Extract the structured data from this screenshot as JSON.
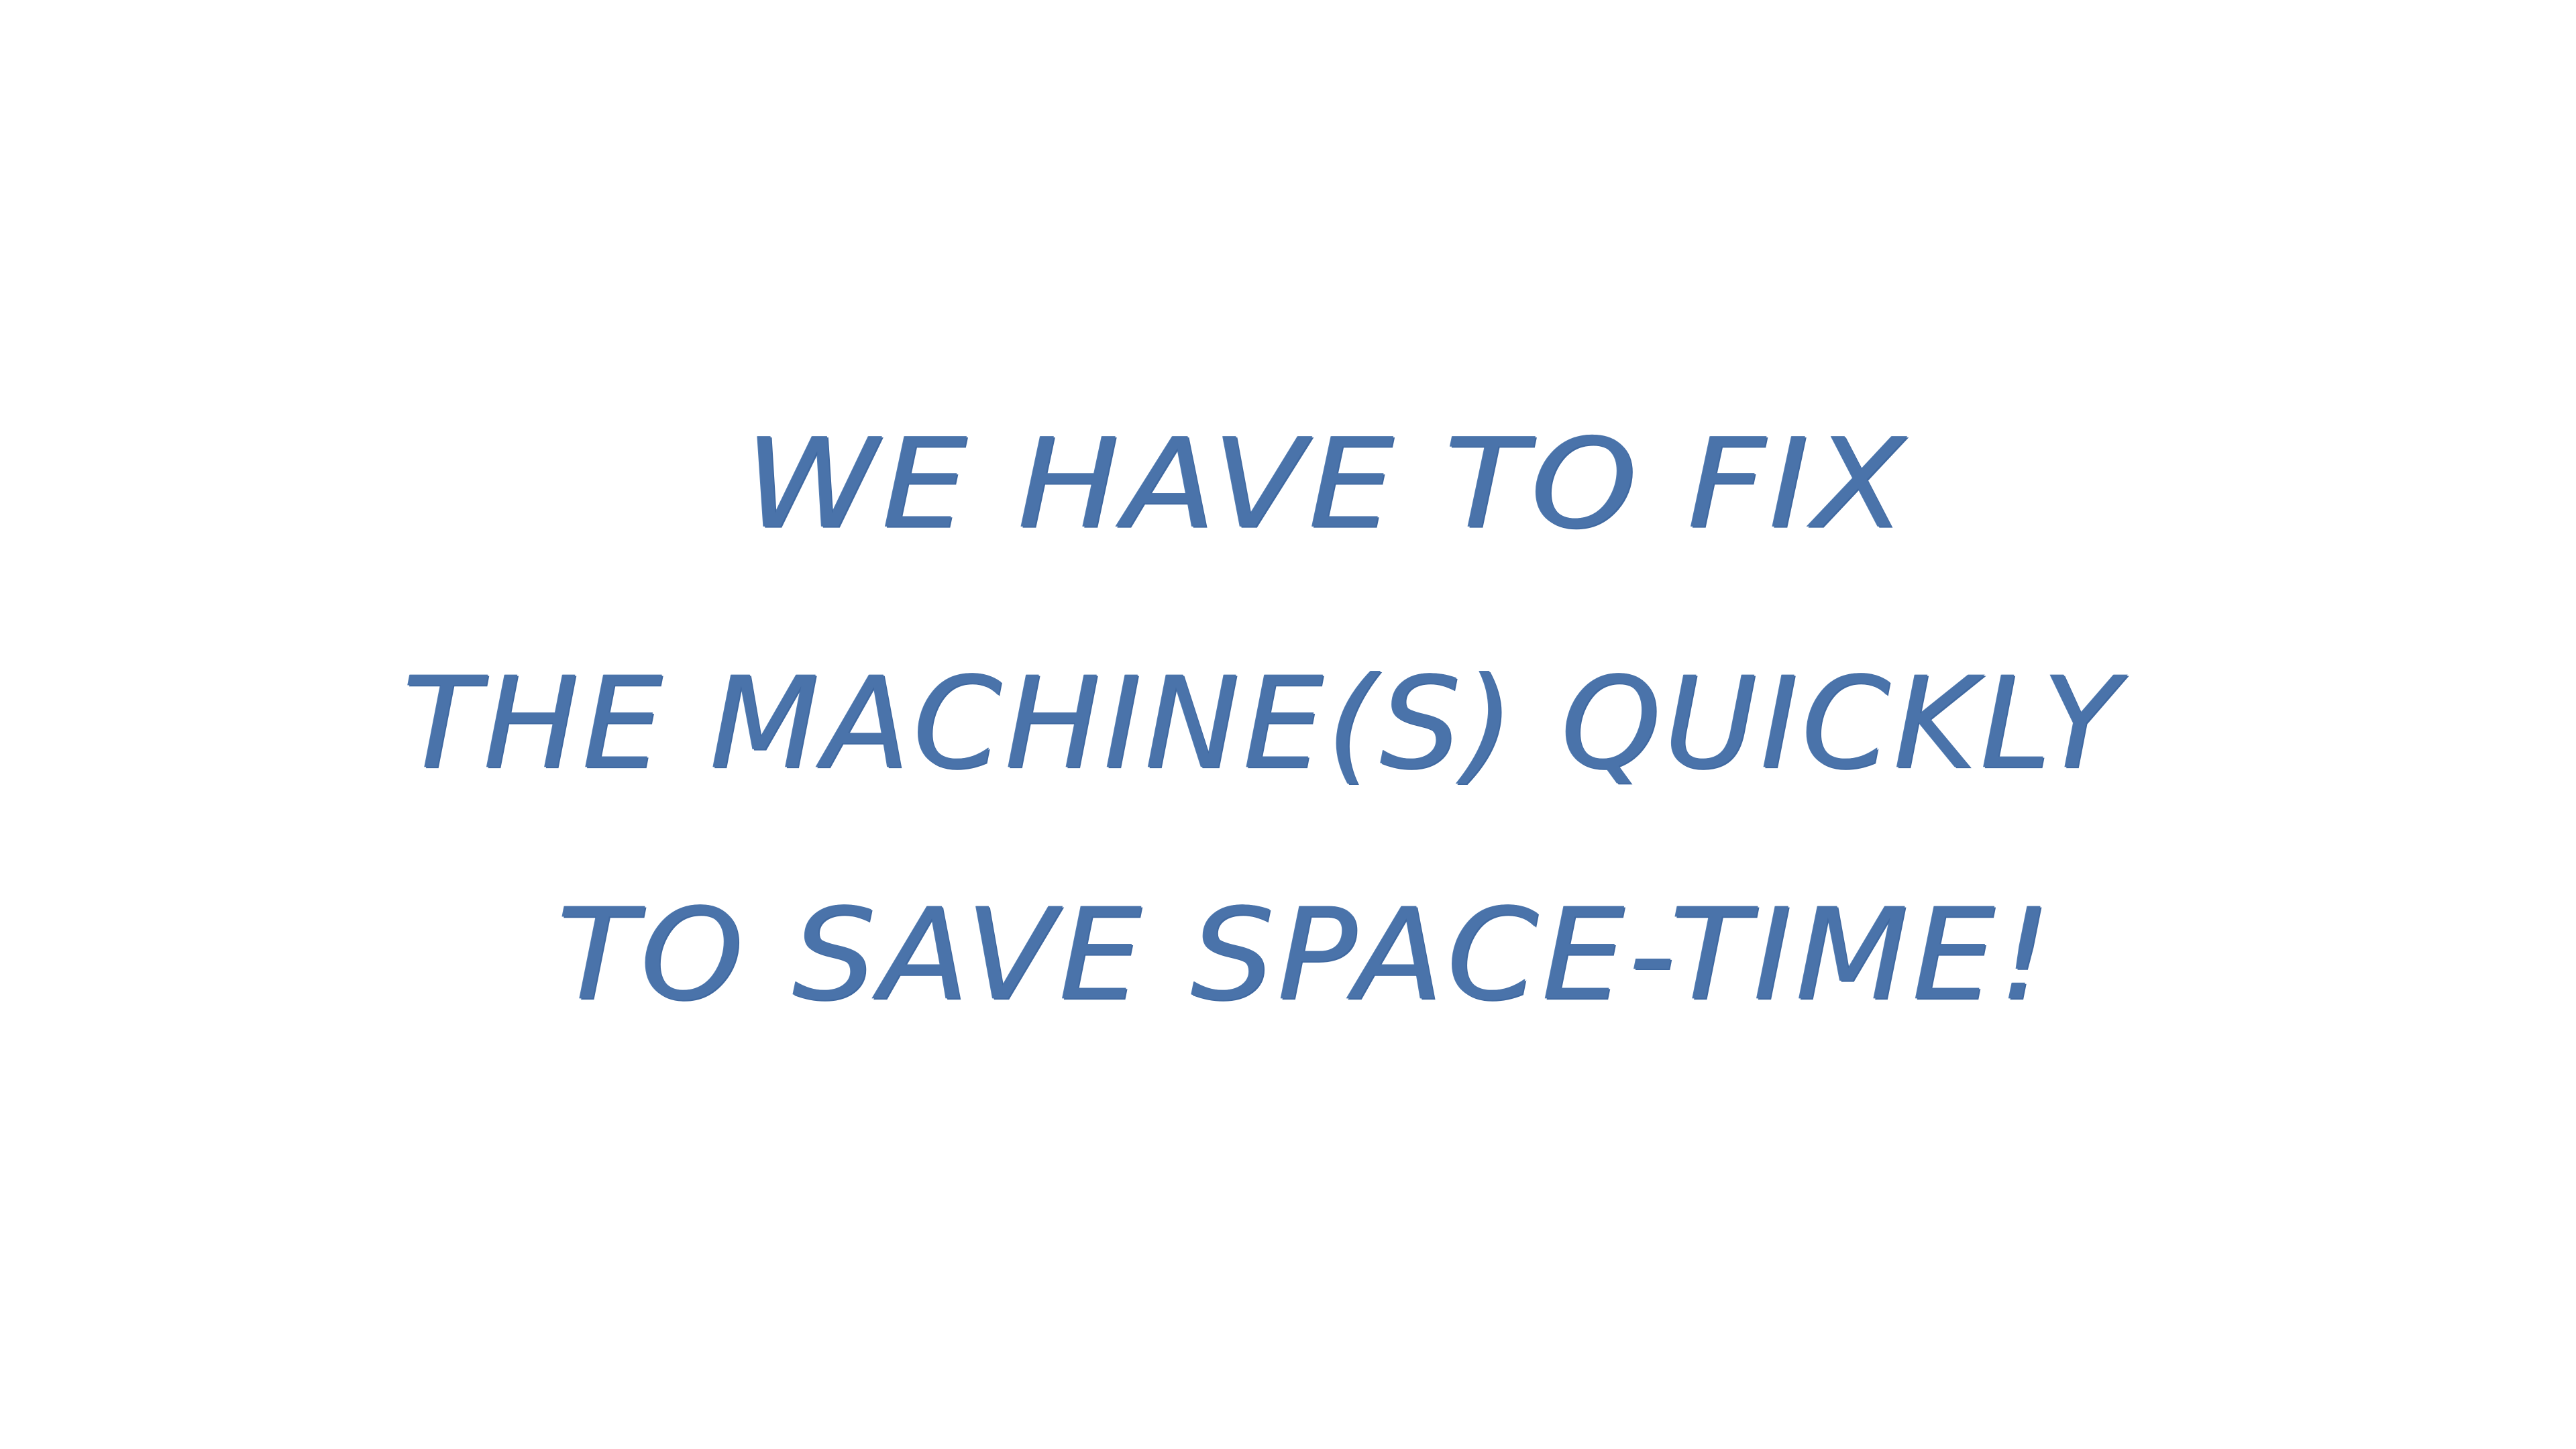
{
  "message": {
    "line1": "WE HAVE TO FIX",
    "line2": "THE MACHINE(S) QUICKLY",
    "line3": "TO SAVE SPACE-TIME!"
  },
  "colors": {
    "ink": "#4a73aa",
    "background": "#ffffff"
  }
}
